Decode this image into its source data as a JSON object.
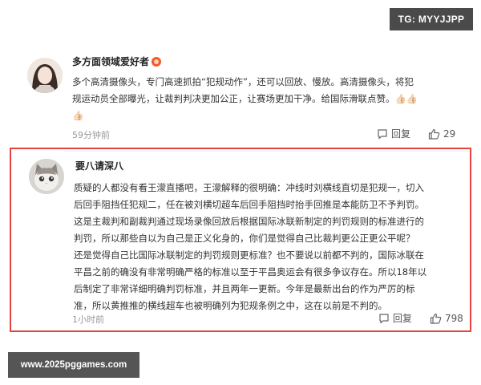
{
  "tg_badge": "TG: MYYJJPP",
  "comments": [
    {
      "username": "多方面领域爱好者",
      "lines": [
        "多个高清摄像头，专门高速抓拍“犯规动作”，还可以回放、慢放。高清摄像头，将犯",
        "规运动员全部曝光，让裁判判决更加公正，让赛场更加干净。给国际滑联点赞。👍🏻👍🏻",
        "👍🏻"
      ],
      "time": "59分钟前",
      "reply_label": "回复",
      "likes": "29"
    },
    {
      "username": "要八请深八",
      "lines": [
        "质疑的人都没有看王濛直播吧，王濛解释的很明确：冲线时刘横线直切是犯规一，切入",
        "后回手阻挡任犯规二，任在被刘横切超车后回手阻挡时抬手回推是本能防卫不予判罚。",
        "这是主裁判和副裁判通过现场录像回放后根据国际冰联新制定的判罚规则的标准进行的",
        "判罚，所以那些自以为自己是正义化身的，你们是觉得自己比裁判更公正更公平呢？",
        "还是觉得自己比国际冰联制定的判罚规则更标准？也不要说以前都不判的，国际冰联在",
        "平昌之前的确没有非常明确严格的标准以至于平昌奥运会有很多争议存在。所以18年以",
        "后制定了非常详细明确判罚标准，并且两年一更新。今年是最新出台的作为严厉的标",
        "准，所以黄推推的横线超车也被明确列为犯规条例之中，这在以前是不判的。"
      ],
      "time": "1小时前",
      "reply_label": "回复",
      "likes": "798"
    }
  ],
  "watermark": "www.2025pggames.com",
  "colors": {
    "highlight_border": "#e64340",
    "meta_text": "#999999",
    "vip_badge": "#f25a29"
  },
  "icons": {
    "reply": "comment-icon",
    "like": "thumbs-up-icon"
  }
}
